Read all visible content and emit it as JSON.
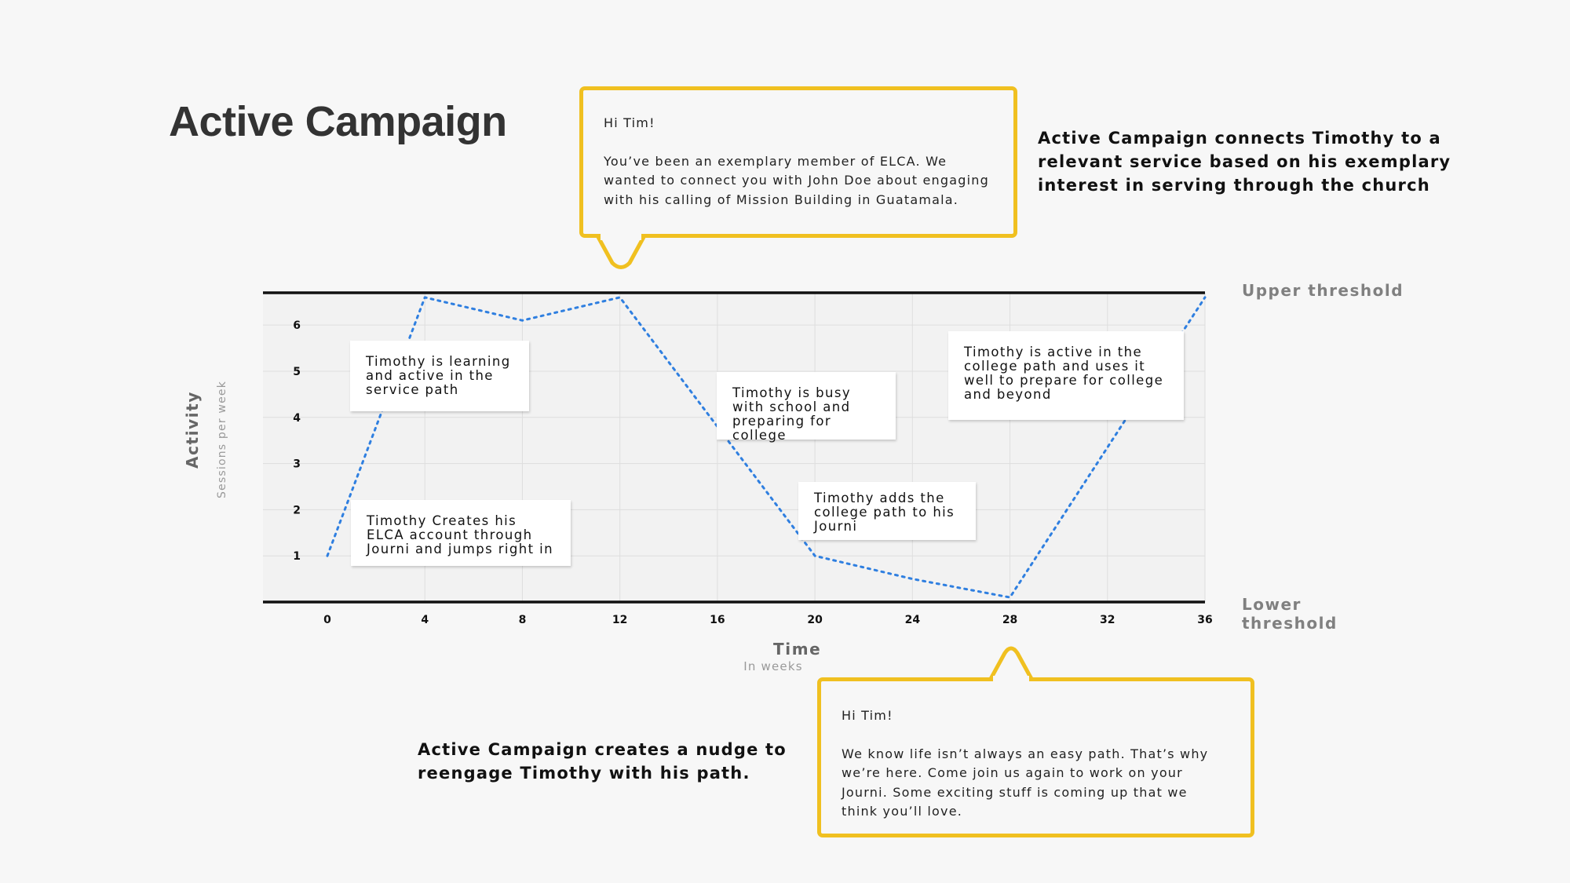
{
  "page": {
    "title": "Active Campaign",
    "top_right_text": "Active Campaign connects Timothy to a relevant service based on his exemplary interest in serving through the church",
    "bottom_left_text": "Active Campaign creates a nudge to reengage Timothy with his path."
  },
  "messages": {
    "top": {
      "greeting": "Hi Tim!",
      "body": "You’ve been an exemplary member of ELCA. We wanted to connect you with John Doe about engaging with his calling of Mission Building in Guatamala."
    },
    "bottom": {
      "greeting": "Hi Tim!",
      "body": "We know life isn’t always an easy path. That’s why we’re here. Come join us again to work on your Journi. Some exciting stuff is coming up that we think you’ll love."
    }
  },
  "chart_data": {
    "type": "line",
    "xlabel": "Time",
    "xlabel_sub": "In weeks",
    "ylabel": "Activity",
    "ylabel_sub": "Sessions per week",
    "xlim": [
      0,
      36
    ],
    "ylim": [
      0,
      6.7
    ],
    "x_ticks": [
      0,
      4,
      8,
      12,
      16,
      20,
      24,
      28,
      32,
      36
    ],
    "y_ticks": [
      1,
      2,
      3,
      4,
      5,
      6
    ],
    "grid": true,
    "series": [
      {
        "line_style": "dotted",
        "color": "#2f7fe0",
        "x": [
          0,
          4,
          8,
          12,
          20,
          24,
          28,
          36
        ],
        "y": [
          1.0,
          6.6,
          6.1,
          6.6,
          1.0,
          0.5,
          0.1,
          6.6
        ]
      }
    ],
    "thresholds": [
      {
        "label": "Upper threshold",
        "y": 6.7
      },
      {
        "label": "Lower threshold",
        "y": 0
      }
    ],
    "annotations": [
      "Timothy is learning and active in the service path",
      "Timothy Creates his ELCA account through Journi and jumps right in",
      "Timothy is busy with school and preparing for college",
      "Timothy adds the college path to his Journi",
      "Timothy is active in the college path and uses it well to prepare for college and beyond"
    ]
  },
  "colors": {
    "accent_yellow": "#f0c020",
    "line_blue": "#2f7fe0",
    "threshold_line": "#111111"
  }
}
